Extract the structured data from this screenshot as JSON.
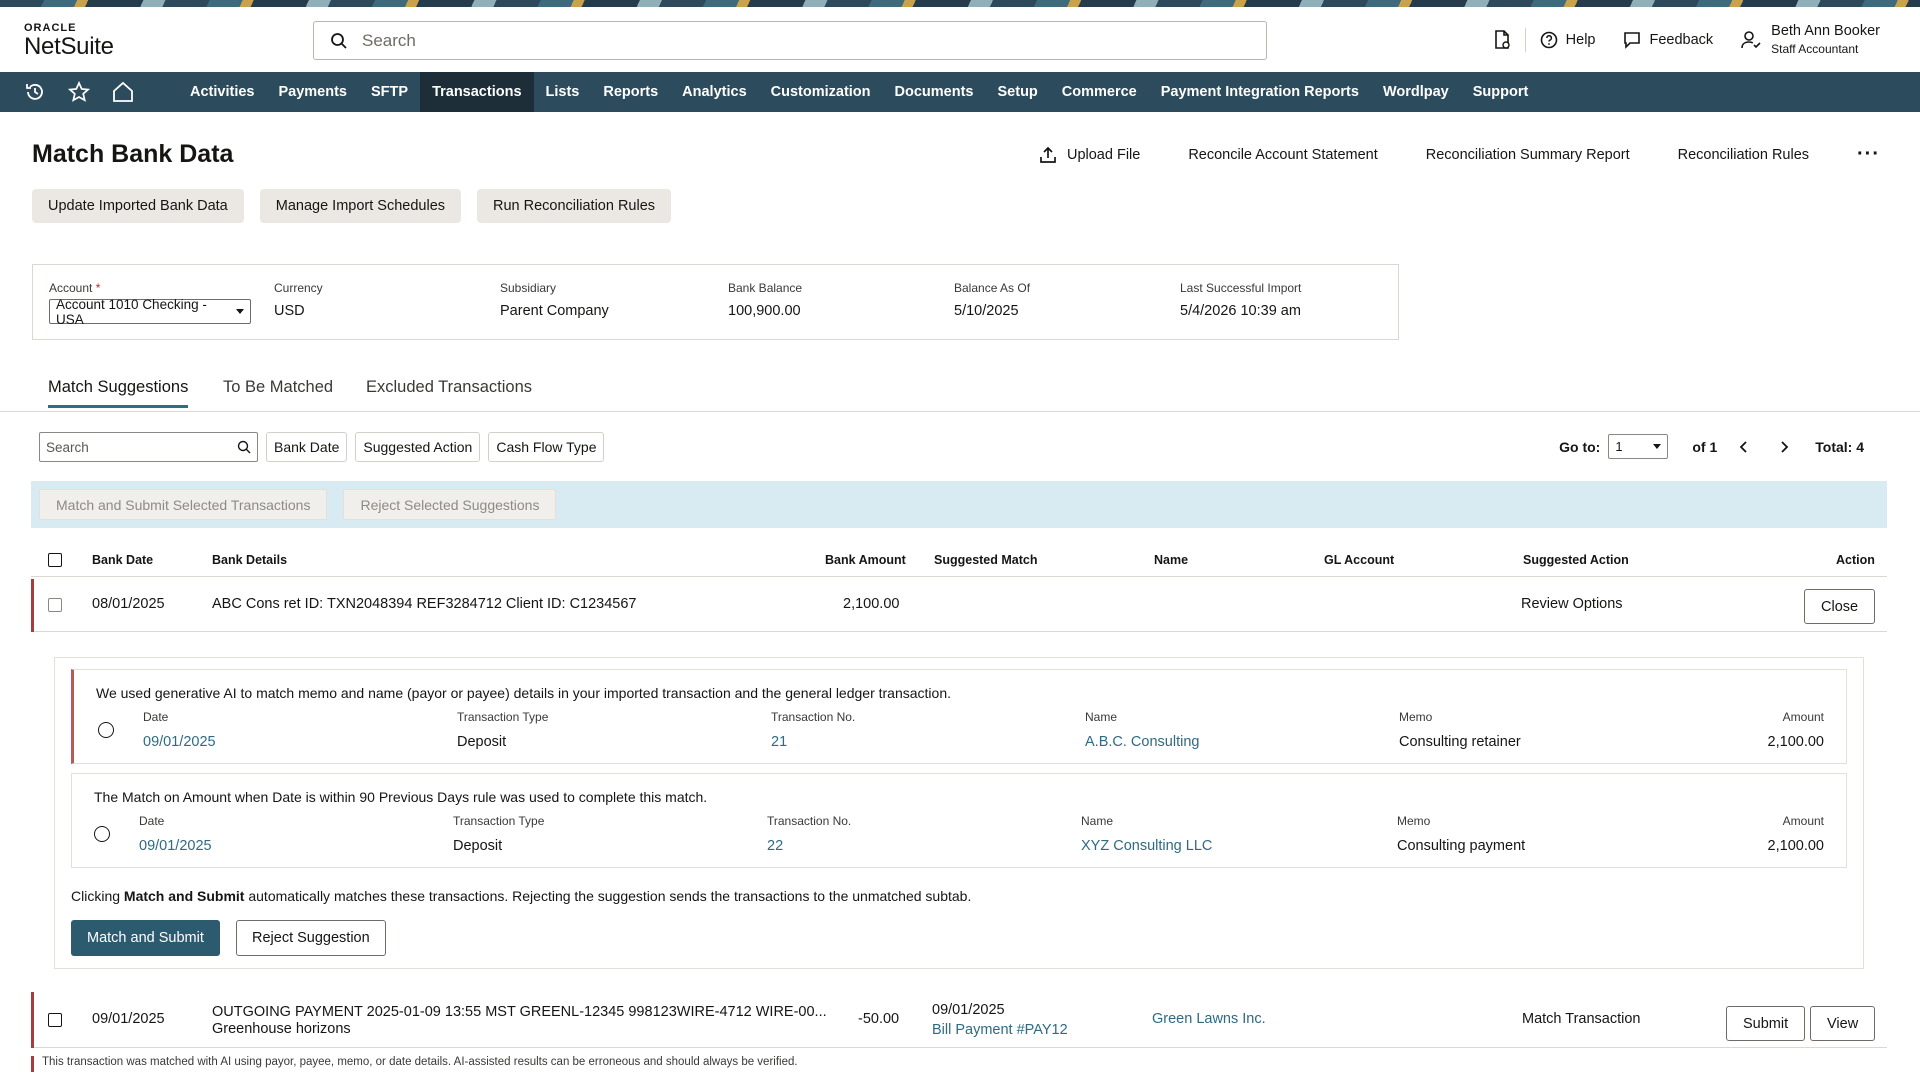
{
  "brand": {
    "oracle": "ORACLE",
    "product": "NetSuite"
  },
  "search": {
    "placeholder": "Search"
  },
  "header": {
    "help": "Help",
    "feedback": "Feedback",
    "user_name": "Beth Ann Booker",
    "user_role": "Staff Accountant"
  },
  "nav": {
    "items": [
      "Activities",
      "Payments",
      "SFTP",
      "Transactions",
      "Lists",
      "Reports",
      "Analytics",
      "Customization",
      "Documents",
      "Setup",
      "Commerce",
      "Payment Integration Reports",
      "Wordlpay",
      "Support"
    ],
    "active": "Transactions"
  },
  "page": {
    "title": "Match Bank Data",
    "actions": {
      "upload": "Upload File",
      "reconcile": "Reconcile Account Statement",
      "summary": "Reconciliation Summary Report",
      "rules": "Reconciliation Rules"
    },
    "buttons": {
      "update": "Update Imported Bank Data",
      "manage": "Manage Import Schedules",
      "run": "Run Reconciliation Rules"
    }
  },
  "account": {
    "account_label": "Account",
    "account_value": "Account 1010 Checking - USA",
    "currency_label": "Currency",
    "currency_value": "USD",
    "subsidiary_label": "Subsidiary",
    "subsidiary_value": "Parent Company",
    "balance_label": "Bank Balance",
    "balance_value": "100,900.00",
    "asof_label": "Balance As Of",
    "asof_value": "5/10/2025",
    "import_label": "Last Successful Import",
    "import_value": "5/4/2026 10:39 am"
  },
  "tabs": [
    "Match Suggestions",
    "To Be Matched",
    "Excluded Transactions"
  ],
  "filters": {
    "search_placeholder": "Search",
    "chips": [
      "Bank Date",
      "Suggested Action",
      "Cash Flow Type"
    ]
  },
  "pager": {
    "goto": "Go to:",
    "page": "1",
    "of": "of 1",
    "total": "Total: 4"
  },
  "bulk": {
    "match": "Match and Submit Selected Transactions",
    "reject": "Reject Selected Suggestions"
  },
  "columns": {
    "bank_date": "Bank Date",
    "bank_details": "Bank Details",
    "bank_amount": "Bank Amount",
    "suggested_match": "Suggested Match",
    "name": "Name",
    "gl_account": "GL Account",
    "suggested_action": "Suggested Action",
    "action": "Action"
  },
  "row1": {
    "date": "08/01/2025",
    "details": "ABC Cons ret ID: TXN2048394 REF3284712 Client ID: C1234567",
    "amount": "2,100.00",
    "suggested_action": "Review Options",
    "action": "Close"
  },
  "suggestions": [
    {
      "intro": "We used generative AI to match memo and name (payor or payee) details in your imported transaction and the general ledger transaction.",
      "date": "09/01/2025",
      "type": "Deposit",
      "number": "21",
      "name": "A.B.C. Consulting",
      "memo": "Consulting retainer",
      "amount": "2,100.00"
    },
    {
      "intro": "The Match on Amount when Date is within 90 Previous Days rule was used to complete this match.",
      "date": "09/01/2025",
      "type": "Deposit",
      "number": "22",
      "name": "XYZ Consulting LLC",
      "memo": "Consulting payment",
      "amount": "2,100.00"
    }
  ],
  "sug_headers": {
    "date": "Date",
    "type": "Transaction Type",
    "number": "Transaction No.",
    "name": "Name",
    "memo": "Memo",
    "amount": "Amount"
  },
  "note": {
    "pre": "Clicking ",
    "bold": "Match and Submit",
    "post": " automatically matches these transactions. Rejecting the suggestion sends the transactions to the unmatched subtab."
  },
  "panel_buttons": {
    "match": "Match and Submit",
    "reject": "Reject Suggestion"
  },
  "row2": {
    "date": "09/01/2025",
    "details_line1": "OUTGOING PAYMENT 2025-01-09 13:55 MST GREENL-12345 998123WIRE-4712 WIRE-00...",
    "details_line2": "Greenhouse horizons",
    "amount": "-50.00",
    "match_date": "09/01/2025",
    "match_link": "Bill Payment #PAY12",
    "name": "Green Lawns Inc.",
    "suggested_action": "Match Transaction",
    "submit": "Submit",
    "view": "View"
  },
  "disclaimer": "This transaction was matched with AI using payor, payee, memo, or date details. AI-assisted results can be erroneous and should always be verified."
}
